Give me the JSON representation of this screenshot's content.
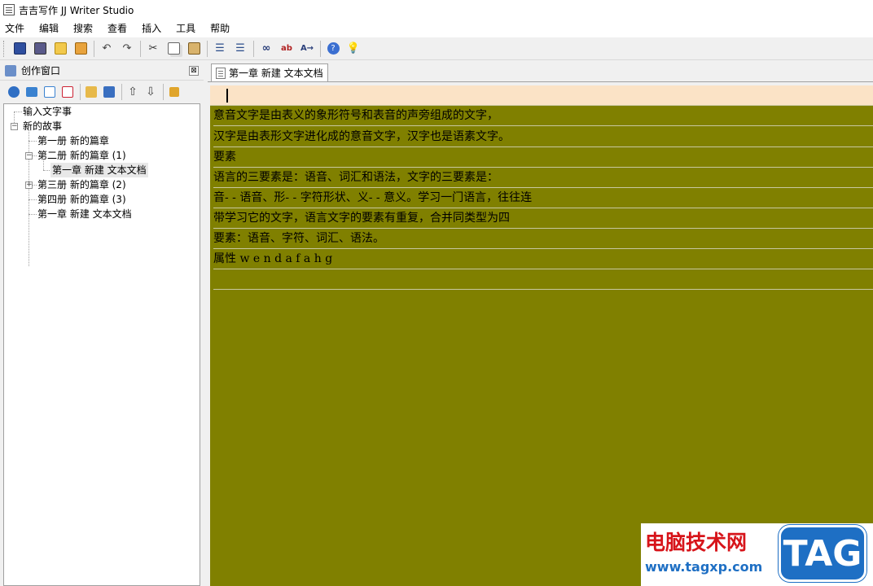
{
  "window": {
    "title": "吉吉写作 JJ Writer Studio"
  },
  "menu": [
    "文件",
    "编辑",
    "搜索",
    "查看",
    "插入",
    "工具",
    "帮助"
  ],
  "toolbar": {
    "icons": [
      "save-icon",
      "save-all-icon",
      "open-folder-icon",
      "close-icon",
      "undo-icon",
      "redo-icon",
      "cut-icon",
      "copy-icon",
      "paste-icon",
      "indent-icon",
      "outdent-icon",
      "find-icon",
      "spell-check-icon",
      "replace-icon",
      "help-icon",
      "tip-icon"
    ]
  },
  "panel": {
    "title": "创作窗口",
    "close_glyph": "⊠",
    "tools": [
      "new-book-icon",
      "new-chapter-icon",
      "new-document-icon",
      "delete-icon",
      "properties-icon",
      "edit-icon",
      "move-up-icon",
      "move-down-icon",
      "lock-icon"
    ]
  },
  "tree": {
    "items": [
      {
        "label": "输入文字事",
        "depth": 0,
        "expander": ""
      },
      {
        "label": "新的故事",
        "depth": 0,
        "expander": "−"
      },
      {
        "label": "第一册 新的篇章",
        "depth": 1,
        "expander": ""
      },
      {
        "label": "第二册 新的篇章 (1)",
        "depth": 1,
        "expander": "−"
      },
      {
        "label": "第一章 新建 文本文档",
        "depth": 2,
        "expander": "",
        "selected": true
      },
      {
        "label": "第三册 新的篇章 (2)",
        "depth": 1,
        "expander": "+"
      },
      {
        "label": "第四册 新的篇章 (3)",
        "depth": 1,
        "expander": ""
      },
      {
        "label": "第一章 新建 文本文档",
        "depth": 1,
        "expander": ""
      }
    ]
  },
  "editor": {
    "tab_label": "第一章 新建 文本文档",
    "lines": [
      "",
      "意音文字是由表义的象形符号和表音的声旁组成的文字，",
      "汉字是由表形文字进化成的意音文字，汉字也是语素文字。",
      "要素",
      "语言的三要素是：语音、词汇和语法，文字的三要素是：",
      "音- - 语音、形- - 字符形状、义- - 意义。学习一门语言，往往连",
      "带学习它的文字，语言文字的要素有重复，合并同类型为四",
      "要素：语音、字符、词汇、语法。",
      "属性  w e n d a f a h g",
      ""
    ],
    "background": "#808000",
    "current_line_color": "#fbe3c6"
  },
  "watermark": {
    "text": "电脑技术网",
    "url": "www.tagxp.com",
    "badge": "TAG"
  }
}
